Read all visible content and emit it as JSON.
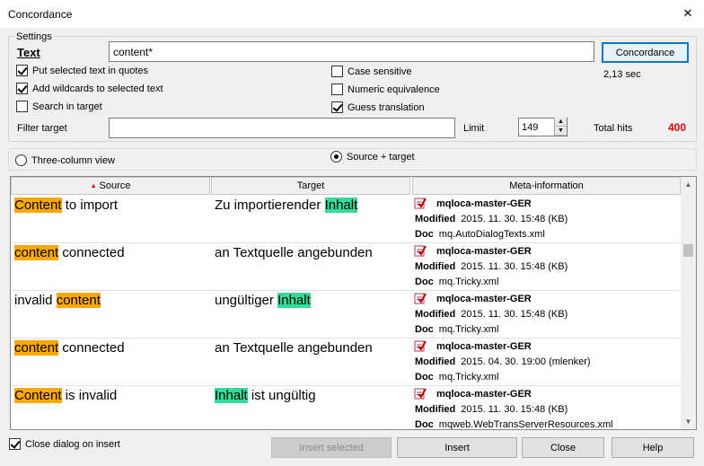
{
  "window": {
    "title": "Concordance",
    "close_glyph": "✕"
  },
  "settings": {
    "group_label": "Settings",
    "text_label": "Text",
    "search_value": "content*",
    "concordance_button": "Concordance",
    "elapsed": "2,13 sec",
    "put_quotes": {
      "label": "Put selected text in quotes",
      "checked": true
    },
    "add_wildcards": {
      "label": "Add wildcards to selected text",
      "checked": true
    },
    "search_target": {
      "label": "Search in target",
      "checked": false
    },
    "case_sensitive": {
      "label": "Case sensitive",
      "checked": false
    },
    "numeric_equivalence": {
      "label": "Numeric equivalence",
      "checked": false
    },
    "guess_translation": {
      "label": "Guess translation",
      "checked": true
    },
    "filter_target_label": "Filter target",
    "filter_target_value": "",
    "limit_label": "Limit",
    "limit_value": "149",
    "total_hits_label": "Total hits",
    "total_hits_value": "400",
    "total_hits_color": "#e00000"
  },
  "view": {
    "three_column": {
      "label": "Three-column view",
      "selected": false
    },
    "source_target": {
      "label": "Source + target",
      "selected": true
    }
  },
  "grid": {
    "headers": {
      "source": "Source",
      "target": "Target",
      "meta": "Meta-information"
    },
    "meta_labels": {
      "modified": "Modified",
      "doc": "Doc"
    },
    "rows": [
      {
        "source": [
          {
            "t": "Content",
            "hl": true
          },
          {
            "t": " to import",
            "hl": false
          }
        ],
        "target": [
          {
            "t": "Zu importierender ",
            "hl": false
          },
          {
            "t": "Inhalt",
            "hl": true
          }
        ],
        "tm": "mqloca-master-GER",
        "modified": "2015. 11. 30. 15:48 (KB)",
        "doc": "mq.AutoDialogTexts.xml"
      },
      {
        "source": [
          {
            "t": "content",
            "hl": true
          },
          {
            "t": " connected",
            "hl": false
          }
        ],
        "target": [
          {
            "t": "an Textquelle angebunden",
            "hl": false
          }
        ],
        "tm": "mqloca-master-GER",
        "modified": "2015. 11. 30. 15:48 (KB)",
        "doc": "mq.Tricky.xml"
      },
      {
        "source": [
          {
            "t": "invalid ",
            "hl": false
          },
          {
            "t": "content",
            "hl": true
          }
        ],
        "target": [
          {
            "t": "ungültiger ",
            "hl": false
          },
          {
            "t": "Inhalt",
            "hl": true
          }
        ],
        "tm": "mqloca-master-GER",
        "modified": "2015. 11. 30. 15:48 (KB)",
        "doc": "mq.Tricky.xml"
      },
      {
        "source": [
          {
            "t": "content",
            "hl": true
          },
          {
            "t": " connected",
            "hl": false
          }
        ],
        "target": [
          {
            "t": "an Textquelle angebunden",
            "hl": false
          }
        ],
        "tm": "mqloca-master-GER",
        "modified": "2015. 04. 30. 19:00 (mlenker)",
        "doc": "mq.Tricky.xml"
      },
      {
        "source": [
          {
            "t": "Content",
            "hl": true
          },
          {
            "t": " is invalid",
            "hl": false
          }
        ],
        "target": [
          {
            "t": "Inhalt",
            "hl": true
          },
          {
            "t": " ist ungültig",
            "hl": false
          }
        ],
        "tm": "mqloca-master-GER",
        "modified": "2015. 11. 30. 15:48 (KB)",
        "doc": "mqweb.WebTransServerResources.xml"
      }
    ]
  },
  "footer": {
    "close_on_insert": {
      "label": "Close dialog on insert",
      "checked": true
    },
    "insert_selected": "Insert selected",
    "insert": "Insert",
    "close": "Close",
    "help": "Help"
  }
}
